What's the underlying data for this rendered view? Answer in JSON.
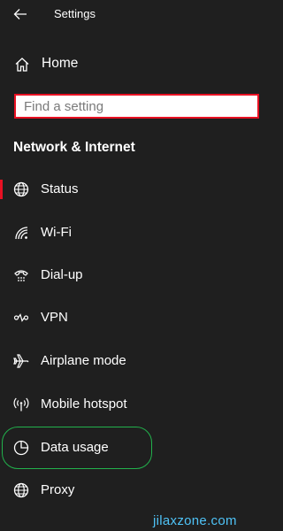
{
  "window": {
    "title": "Settings"
  },
  "home": {
    "label": "Home",
    "icon": "home-icon"
  },
  "search": {
    "placeholder": "Find a setting",
    "value": ""
  },
  "section": {
    "title": "Network & Internet"
  },
  "colors": {
    "accent": "#e81123",
    "highlight": "#22b14c",
    "background": "#1f1f1f",
    "watermark": "#4fc3f7"
  },
  "nav": {
    "items": [
      {
        "label": "Status",
        "icon": "globe-icon",
        "selected": true
      },
      {
        "label": "Wi-Fi",
        "icon": "wifi-icon"
      },
      {
        "label": "Dial-up",
        "icon": "dialup-icon"
      },
      {
        "label": "VPN",
        "icon": "vpn-icon"
      },
      {
        "label": "Airplane mode",
        "icon": "airplane-icon"
      },
      {
        "label": "Mobile hotspot",
        "icon": "hotspot-icon"
      },
      {
        "label": "Data usage",
        "icon": "data-usage-icon",
        "annotated": true
      },
      {
        "label": "Proxy",
        "icon": "globe-icon"
      }
    ]
  },
  "watermark": {
    "text": "jilaxzone.com"
  }
}
